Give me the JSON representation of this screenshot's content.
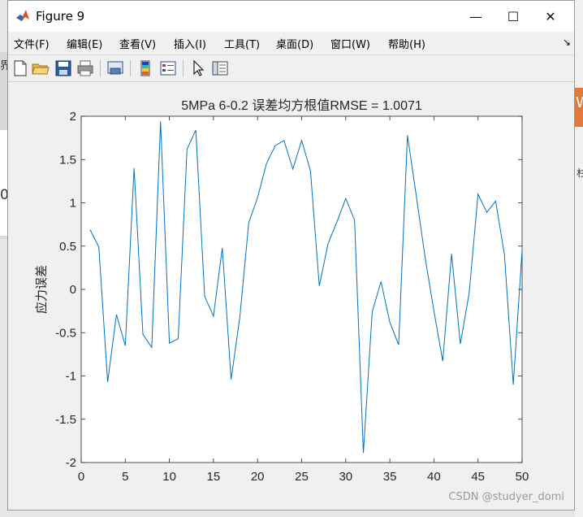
{
  "window": {
    "title": "Figure 9",
    "controls": {
      "minimize": "—",
      "maximize": "☐",
      "close": "✕"
    }
  },
  "menu": {
    "items": [
      "文件(F)",
      "编辑(E)",
      "查看(V)",
      "插入(I)",
      "工具(T)",
      "桌面(D)",
      "窗口(W)",
      "帮助(H)"
    ],
    "overflow": "↘"
  },
  "toolbar": {
    "buttons": [
      "new-figure-icon",
      "open-file-icon",
      "save-icon",
      "print-icon",
      "link-icon",
      "colorbar-icon",
      "legend-icon",
      "pointer-icon",
      "property-inspector-icon"
    ]
  },
  "background": {
    "left_glyph_top": "界",
    "left_glyph_mid": "0",
    "right_glyph": "W",
    "right_glyph2": "杉"
  },
  "chart_data": {
    "type": "line",
    "title": "5MPa 6-0.2 误差均方根值RMSE = 1.0071",
    "xlabel": "",
    "ylabel": "应力误差",
    "xlim": [
      0,
      50
    ],
    "ylim": [
      -2,
      2
    ],
    "xticks": [
      "0",
      "5",
      "10",
      "15",
      "20",
      "25",
      "30",
      "35",
      "40",
      "45",
      "50"
    ],
    "yticks": [
      "-2",
      "-1.5",
      "-1",
      "-0.5",
      "0",
      "0.5",
      "1",
      "1.5",
      "2"
    ],
    "grid": false,
    "line_color": "#0072bd",
    "series": [
      {
        "x": [
          1,
          2,
          3,
          4,
          5,
          6,
          7,
          8,
          9,
          10,
          11,
          12,
          13,
          14,
          15,
          16,
          17,
          18,
          19,
          20,
          21,
          22,
          23,
          24,
          25,
          26,
          27,
          28,
          29,
          30,
          31,
          32,
          33,
          34,
          35,
          36,
          37,
          38,
          39,
          40,
          41,
          42,
          43,
          44,
          45,
          46,
          47,
          48,
          49,
          50
        ],
        "y": [
          0.69,
          0.49,
          -1.07,
          -0.29,
          -0.65,
          1.4,
          -0.52,
          -0.67,
          1.94,
          -0.62,
          -0.57,
          1.62,
          1.84,
          -0.08,
          -0.31,
          0.48,
          -1.04,
          -0.31,
          0.77,
          1.06,
          1.45,
          1.66,
          1.72,
          1.39,
          1.72,
          1.37,
          0.04,
          0.53,
          0.78,
          1.05,
          0.8,
          -1.89,
          -0.26,
          0.09,
          -0.38,
          -0.64,
          1.78,
          1.08,
          0.37,
          -0.25,
          -0.83,
          0.41,
          -0.63,
          -0.04,
          1.1,
          0.89,
          1.02,
          0.4,
          -1.1,
          0.45
        ]
      }
    ]
  },
  "watermark": "CSDN @studyer_domi"
}
